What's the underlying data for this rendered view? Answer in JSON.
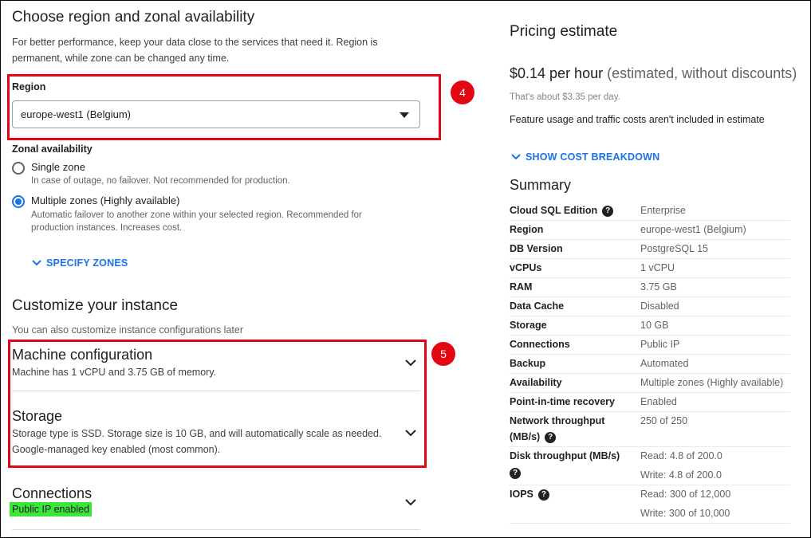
{
  "region_section": {
    "title": "Choose region and zonal availability",
    "description": "For better performance, keep your data close to the services that need it. Region is permanent, while zone can be changed any time.",
    "region_label": "Region",
    "region_value": "europe-west1 (Belgium)",
    "zonal_label": "Zonal availability",
    "options": [
      {
        "label": "Single zone",
        "help": "In case of outage, no failover. Not recommended for production.",
        "selected": false
      },
      {
        "label": "Multiple zones (Highly available)",
        "help": "Automatic failover to another zone within your selected region. Recommended for production instances. Increases cost.",
        "selected": true
      }
    ],
    "specify_zones": "SPECIFY ZONES"
  },
  "customize": {
    "title": "Customize your instance",
    "description": "You can also customize instance configurations later",
    "panels": [
      {
        "title": "Machine configuration",
        "lines": [
          "Machine has 1 vCPU and 3.75 GB of memory."
        ]
      },
      {
        "title": "Storage",
        "lines": [
          "Storage type is SSD. Storage size is 10 GB, and will automatically scale as needed.",
          "Google-managed key enabled (most common)."
        ]
      },
      {
        "title": "Connections",
        "lines": [
          "Public IP enabled"
        ]
      }
    ]
  },
  "annotations": {
    "badge_4": "4",
    "badge_5": "5",
    "box_color": "#e30613",
    "highlight_color": "#39e639"
  },
  "pricing": {
    "title": "Pricing estimate",
    "price": "$0.14 per hour",
    "price_note": "(estimated, without discounts)",
    "per_day": "That's about $3.35 per day.",
    "feature_note": "Feature usage and traffic costs aren't included in estimate",
    "breakdown": "SHOW COST BREAKDOWN"
  },
  "summary": {
    "title": "Summary",
    "rows": [
      {
        "key": "Cloud SQL Edition",
        "value": [
          "Enterprise"
        ],
        "help": true
      },
      {
        "key": "Region",
        "value": [
          "europe-west1 (Belgium)"
        ]
      },
      {
        "key": "DB Version",
        "value": [
          "PostgreSQL 15"
        ]
      },
      {
        "key": "vCPUs",
        "value": [
          "1 vCPU"
        ]
      },
      {
        "key": "RAM",
        "value": [
          "3.75 GB"
        ]
      },
      {
        "key": "Data Cache",
        "value": [
          "Disabled"
        ]
      },
      {
        "key": "Storage",
        "value": [
          "10 GB"
        ]
      },
      {
        "key": "Connections",
        "value": [
          "Public IP"
        ]
      },
      {
        "key": "Backup",
        "value": [
          "Automated"
        ]
      },
      {
        "key": "Availability",
        "value": [
          "Multiple zones (Highly available)"
        ]
      },
      {
        "key": "Point-in-time recovery",
        "value": [
          "Enabled"
        ]
      },
      {
        "key": "Network throughput (MB/s)",
        "value": [
          "250 of 250"
        ],
        "help": true
      },
      {
        "key": "Disk throughput (MB/s)",
        "value": [
          "Read: 4.8 of 200.0",
          "Write: 4.8 of 200.0"
        ],
        "help": true
      },
      {
        "key": "IOPS",
        "value": [
          "Read: 300 of 12,000",
          "Write: 300 of 10,000"
        ],
        "help": true
      }
    ]
  }
}
